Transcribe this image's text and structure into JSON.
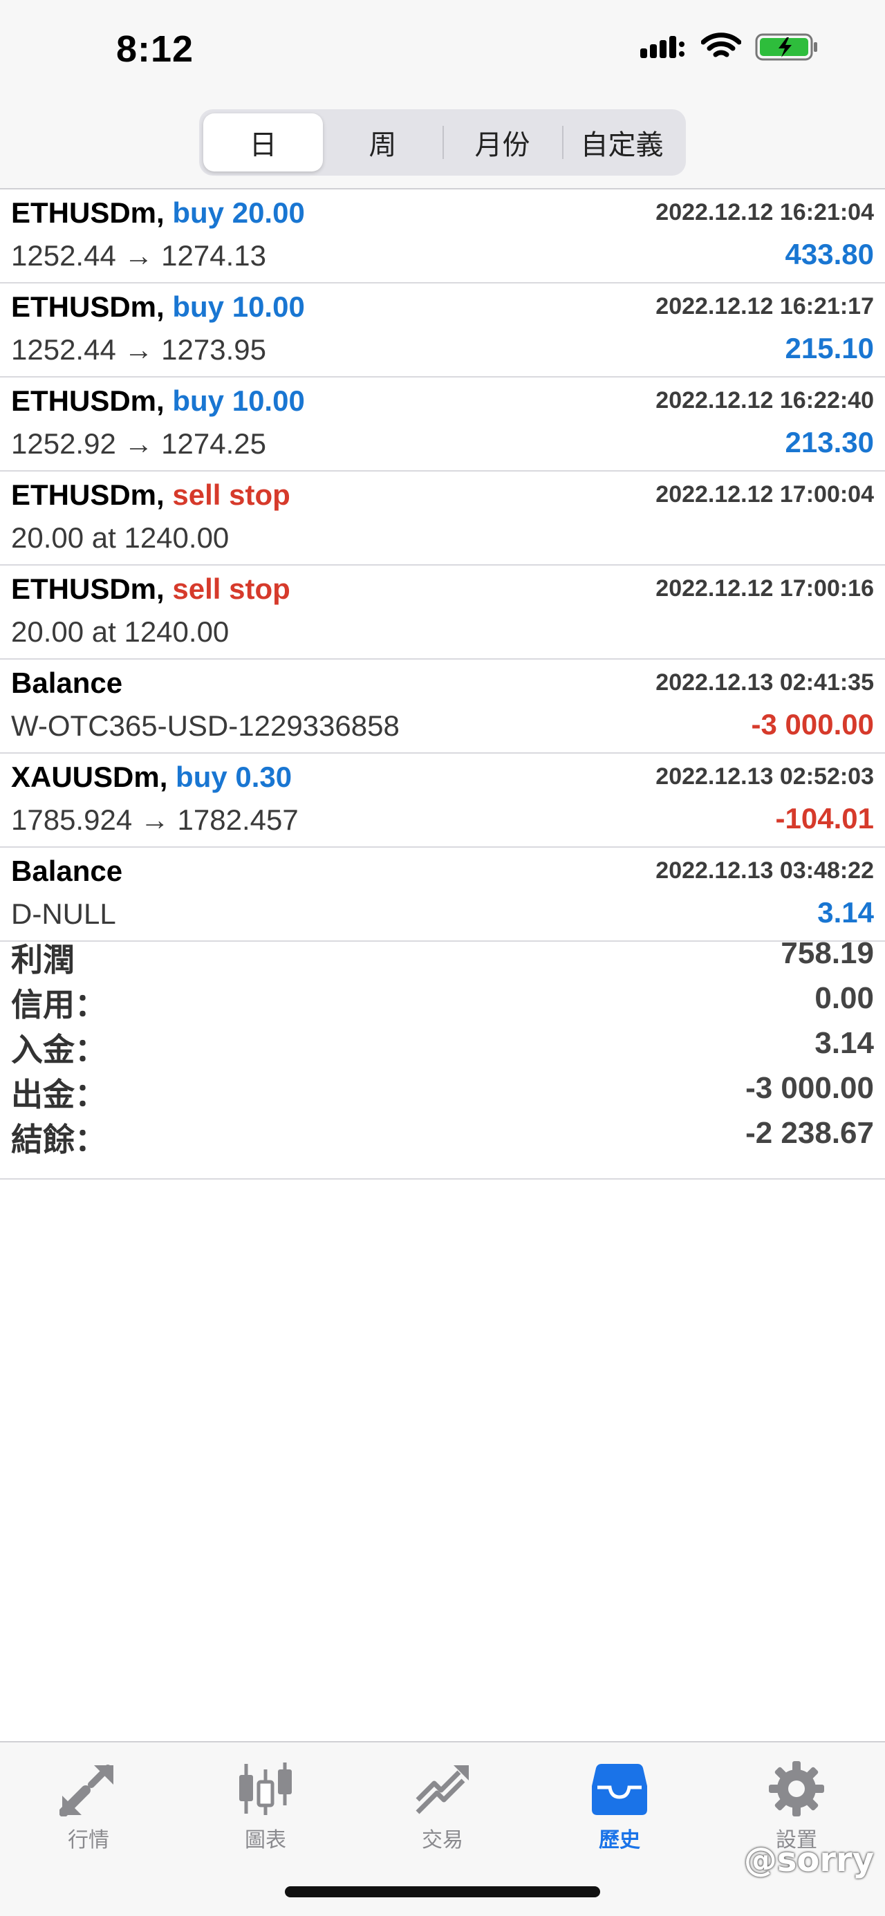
{
  "status": {
    "time": "8:12"
  },
  "tabs": [
    {
      "label": "日"
    },
    {
      "label": "周"
    },
    {
      "label": "月份"
    },
    {
      "label": "自定義"
    }
  ],
  "history": [
    {
      "symbol": "ETHUSDm,",
      "action": "buy 20.00",
      "action_color": "#1976d2",
      "time": "2022.12.12 16:21:04",
      "detail": "1252.44 → 1274.13",
      "profit": "433.80",
      "profit_color": "#1976d2"
    },
    {
      "symbol": "ETHUSDm,",
      "action": "buy 10.00",
      "action_color": "#1976d2",
      "time": "2022.12.12 16:21:17",
      "detail": "1252.44 → 1273.95",
      "profit": "215.10",
      "profit_color": "#1976d2"
    },
    {
      "symbol": "ETHUSDm,",
      "action": "buy 10.00",
      "action_color": "#1976d2",
      "time": "2022.12.12 16:22:40",
      "detail": "1252.92 → 1274.25",
      "profit": "213.30",
      "profit_color": "#1976d2"
    },
    {
      "symbol": "ETHUSDm,",
      "action": "sell stop",
      "action_color": "#d63a2b",
      "time": "2022.12.12 17:00:04",
      "detail": "20.00 at 1240.00",
      "profit": "",
      "profit_color": "#1976d2"
    },
    {
      "symbol": "ETHUSDm,",
      "action": "sell stop",
      "action_color": "#d63a2b",
      "time": "2022.12.12 17:00:16",
      "detail": "20.00 at 1240.00",
      "profit": "",
      "profit_color": "#1976d2"
    },
    {
      "symbol": "Balance",
      "action": "",
      "action_color": "#1976d2",
      "time": "2022.12.13 02:41:35",
      "detail": "W-OTC365-USD-1229336858",
      "profit": "-3 000.00",
      "profit_color": "#d63a2b"
    },
    {
      "symbol": "XAUUSDm,",
      "action": "buy 0.30",
      "action_color": "#1976d2",
      "time": "2022.12.13 02:52:03",
      "detail": "1785.924 → 1782.457",
      "profit": "-104.01",
      "profit_color": "#d63a2b"
    },
    {
      "symbol": "Balance",
      "action": "",
      "action_color": "#1976d2",
      "time": "2022.12.13 03:48:22",
      "detail": "D-NULL",
      "profit": "3.14",
      "profit_color": "#1976d2"
    }
  ],
  "totals": [
    {
      "label": "利潤",
      "value": "758.19"
    },
    {
      "label": "信用：",
      "value": "0.00"
    },
    {
      "label": "入金：",
      "value": "3.14"
    },
    {
      "label": "出金：",
      "value": "-3 000.00"
    },
    {
      "label": "結餘：",
      "value": "-2 238.67"
    }
  ],
  "tabbar": [
    {
      "label": "行情",
      "icon": "quotes-icon"
    },
    {
      "label": "圖表",
      "icon": "chart-icon"
    },
    {
      "label": "交易",
      "icon": "trade-icon"
    },
    {
      "label": "歷史",
      "icon": "history-icon"
    },
    {
      "label": "設置",
      "icon": "settings-icon"
    }
  ],
  "colors": {
    "accent": "#1a73e8",
    "profit_positive": "#1976d2",
    "profit_negative": "#d63a2b",
    "inactive": "#8a8a8e"
  },
  "watermark": "@sorry"
}
